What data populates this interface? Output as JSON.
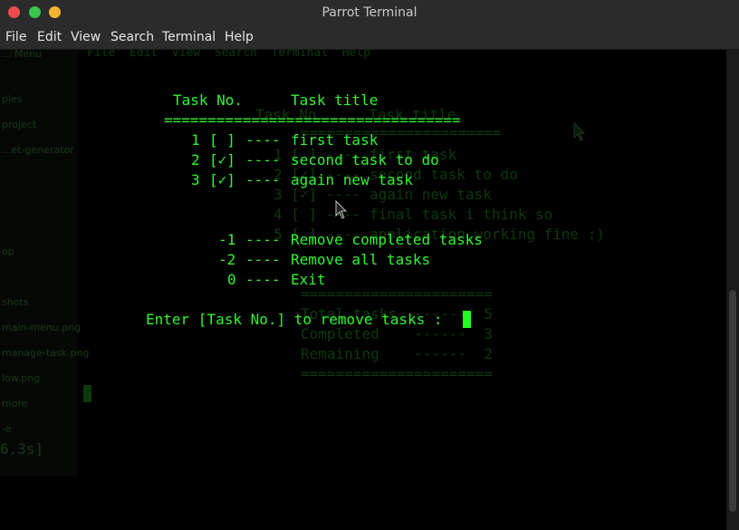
{
  "window": {
    "title": "Parrot Terminal",
    "controls": [
      "close",
      "minimize",
      "maximize"
    ]
  },
  "menu": [
    "File",
    "Edit",
    "View",
    "Search",
    "Terminal",
    "Help"
  ],
  "terminal": {
    "header": {
      "task_no": "Task No.",
      "task_title": "Task title"
    },
    "divider": "==================================",
    "tasks": [
      {
        "no": "1",
        "check": "[ ]",
        "sep": "----",
        "title": "first task"
      },
      {
        "no": "2",
        "check": "[✓]",
        "sep": "----",
        "title": "second task to do"
      },
      {
        "no": "3",
        "check": "[✓]",
        "sep": "----",
        "title": "again new task"
      }
    ],
    "options": [
      {
        "code": "-1",
        "sep": "----",
        "label": "Remove completed tasks"
      },
      {
        "code": "-2",
        "sep": "----",
        "label": "Remove all tasks"
      },
      {
        "code": "0",
        "sep": "----",
        "label": "Exit"
      }
    ],
    "prompt": "Enter [Task No.] to remove tasks :"
  },
  "ghost": {
    "menu": "File  Edit  View  Search  Terminal  Help",
    "header": "Task No.     Task title",
    "divider": "=======================",
    "lines": [
      "1 [ ] ---- first task",
      "2 [✓] ---- second task to do",
      "3 [✓] ---- again new task",
      "4 [ ] ---- final task i think so",
      "5 [ ] ---- application working fine :)"
    ],
    "divider2": "======================",
    "stats": [
      "Total tasks  ------  5",
      "Completed    ------  3",
      "Remaining    ------  2"
    ],
    "divider3": "======================",
    "side_items": [
      "... Menu",
      "ples",
      "project",
      "...et-generator",
      "op",
      "shots",
      "main-menu.png",
      "manage-task.png",
      "low.png",
      "more",
      "-e"
    ],
    "timing": "6.3s]"
  },
  "colors": {
    "term_fg": "#2ff52f",
    "term_bg": "#000000",
    "chrome_bg": "#2b2b2b"
  }
}
